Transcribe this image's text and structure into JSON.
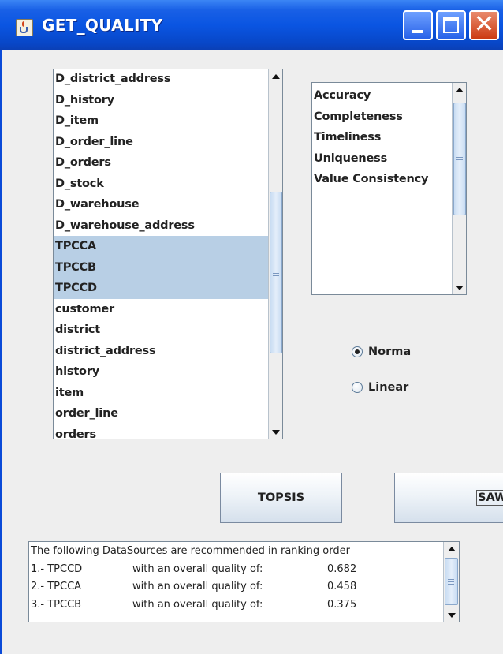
{
  "window": {
    "title": "GET_QUALITY",
    "icon": "java-cup-icon",
    "colors": {
      "titlebar": "#0a55e2",
      "client": "#eeeeee",
      "selection": "#b8cfe5"
    }
  },
  "sources_list": {
    "items": [
      {
        "label": "D_district_address",
        "selected": false
      },
      {
        "label": "D_history",
        "selected": false
      },
      {
        "label": "D_item",
        "selected": false
      },
      {
        "label": "D_order_line",
        "selected": false
      },
      {
        "label": "D_orders",
        "selected": false
      },
      {
        "label": "D_stock",
        "selected": false
      },
      {
        "label": "D_warehouse",
        "selected": false
      },
      {
        "label": "D_warehouse_address",
        "selected": false
      },
      {
        "label": "TPCCA",
        "selected": true
      },
      {
        "label": "TPCCB",
        "selected": true
      },
      {
        "label": "TPCCD",
        "selected": true
      },
      {
        "label": "customer",
        "selected": false
      },
      {
        "label": "district",
        "selected": false
      },
      {
        "label": "district_address",
        "selected": false
      },
      {
        "label": "history",
        "selected": false
      },
      {
        "label": "item",
        "selected": false
      },
      {
        "label": "order_line",
        "selected": false
      },
      {
        "label": "orders",
        "selected": false
      }
    ]
  },
  "criteria_list": {
    "items": [
      {
        "label": "Accuracy"
      },
      {
        "label": "Completeness"
      },
      {
        "label": "Timeliness"
      },
      {
        "label": "Uniqueness"
      },
      {
        "label": "Value Consistency"
      }
    ]
  },
  "normalization": {
    "options": [
      {
        "label": "Norma",
        "checked": true
      },
      {
        "label": "Linear",
        "checked": false
      }
    ]
  },
  "buttons": {
    "topsis": "TOPSIS",
    "saw": "SAW"
  },
  "result": {
    "header": "The following DataSources are recommended in ranking order",
    "rows": [
      {
        "rank": "1.- TPCCD",
        "text": "with an overall quality of:",
        "value": "0.682"
      },
      {
        "rank": "2.- TPCCA",
        "text": "with an overall quality of:",
        "value": "0.458"
      },
      {
        "rank": "3.- TPCCB",
        "text": "with an overall quality of:",
        "value": "0.375"
      }
    ]
  }
}
